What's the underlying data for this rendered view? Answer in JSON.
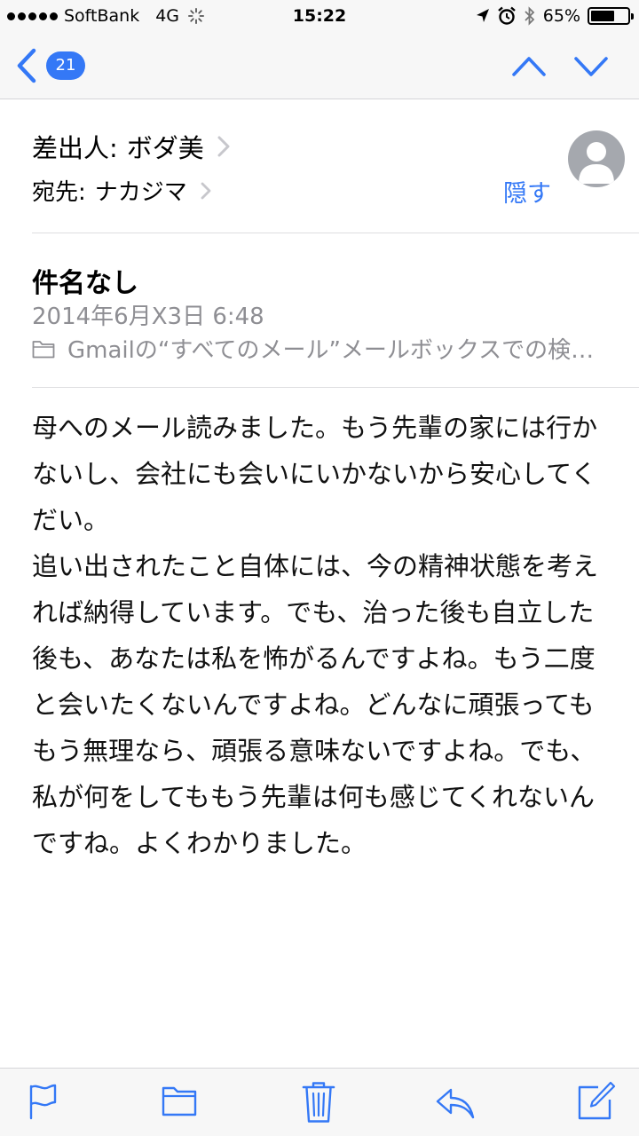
{
  "status_bar": {
    "carrier": "SoftBank",
    "network": "4G",
    "time": "15:22",
    "battery": "65%",
    "battery_level": 0.65
  },
  "nav": {
    "back_count": "21"
  },
  "header": {
    "from_label": "差出人:",
    "from_value": "ボダ美",
    "to_label": "宛先:",
    "to_value": "ナカジマ",
    "hide_label": "隠す",
    "subject": "件名なし",
    "date": "2014年6月X3日 6:48",
    "mailbox": "Gmailの“すべてのメール”メールボックスでの検…"
  },
  "body": "母へのメール読みました。もう先輩の家には行かないし、会社にも会いにいかないから安心してくだい。\n追い出されたこと自体には、今の精神状態を考えれば納得しています。でも、治った後も自立した後も、あなたは私を怖がるんですよね。もう二度と会いたくないんですよね。どんなに頑張ってももう無理なら、頑張る意味ないですよね。でも、私が何をしてももう先輩は何も感じてくれないんですね。よくわかりました。",
  "colors": {
    "accent": "#3478f6",
    "secondary_text": "#8e8e93",
    "bar_background": "#f7f7f7"
  },
  "icons": {
    "toolbar": [
      "flag-icon",
      "folder-icon",
      "trash-icon",
      "reply-icon",
      "compose-icon"
    ]
  }
}
